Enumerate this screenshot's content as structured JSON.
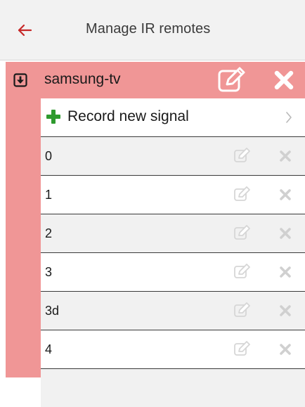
{
  "header": {
    "back_icon": "arrow-left-icon",
    "title": "Manage IR remotes",
    "accent_color": "#c62828"
  },
  "remote": {
    "name": "samsung-tv",
    "toggle_icon": "arrow-down-box-icon",
    "edit_icon": "edit-icon",
    "delete_icon": "close-icon",
    "group_color": "#f09696",
    "record": {
      "label": "Record new signal",
      "icon": "plus-icon",
      "icon_color": "#2e9a2e",
      "chevron_icon": "chevron-right-icon"
    },
    "signals": [
      {
        "label": "0"
      },
      {
        "label": "1"
      },
      {
        "label": "2"
      },
      {
        "label": "3"
      },
      {
        "label": "3d"
      },
      {
        "label": "4"
      }
    ]
  }
}
